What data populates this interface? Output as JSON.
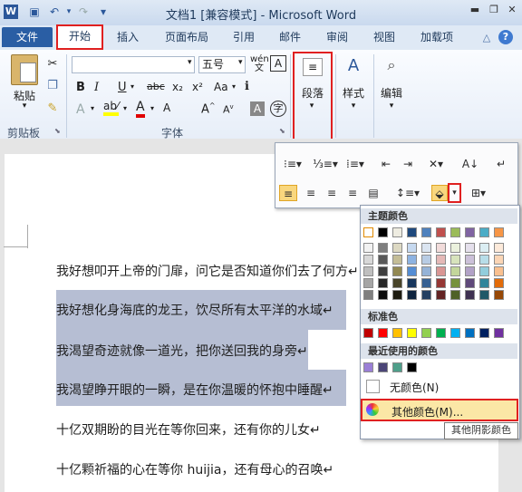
{
  "window": {
    "title": "文档1 [兼容模式] - Microsoft Word"
  },
  "tabs": [
    "文件",
    "开始",
    "插入",
    "页面布局",
    "引用",
    "邮件",
    "审阅",
    "视图",
    "加载项"
  ],
  "ribbon": {
    "paste_label": "粘贴",
    "clipboard_label": "剪贴板",
    "font_label": "字体",
    "font_size": "五号",
    "paragraph_label": "段落",
    "styles_label": "样式",
    "editing_label": "编辑"
  },
  "document": {
    "lines": [
      "我好想叩开上帝的门扉，问它是否知道你们去了何方↵",
      "我好想化身海底的龙王，饮尽所有太平洋的水域↵",
      "我渴望奇迹就像一道光，把你送回我的身旁↵",
      "我渴望睁开眼的一瞬，是在你温暖的怀抱中睡醒↵",
      "十亿双期盼的目光在等你回来，还有你的儿女↵",
      "十亿颗祈福的心在等你 huijia，还有母心的召唤↵"
    ]
  },
  "shading_menu": {
    "theme_colors_label": "主题颜色",
    "standard_colors_label": "标准色",
    "recent_colors_label": "最近使用的颜色",
    "no_color_label": "无颜色(N)",
    "more_colors_label": "其他颜色(M)...",
    "tooltip": "其他阴影颜色",
    "theme_top": [
      "#ffffff",
      "#000000",
      "#eeece1",
      "#1f497d",
      "#4f81bd",
      "#c0504d",
      "#9bbb59",
      "#8064a2",
      "#4bacc6",
      "#f79646"
    ],
    "theme_tints": [
      [
        "#f2f2f2",
        "#7f7f7f",
        "#ddd9c3",
        "#c6d9f0",
        "#dbe5f1",
        "#f2dcdb",
        "#ebf1dd",
        "#e5e0ec",
        "#dbeef3",
        "#fdeada"
      ],
      [
        "#d8d8d8",
        "#595959",
        "#c4bd97",
        "#8db3e2",
        "#b8cce4",
        "#e5b9b7",
        "#d7e3bc",
        "#ccc1d9",
        "#b7dde8",
        "#fbd5b5"
      ],
      [
        "#bfbfbf",
        "#3f3f3f",
        "#938953",
        "#548dd4",
        "#95b3d7",
        "#d99694",
        "#c3d69b",
        "#b2a2c7",
        "#92cddc",
        "#fac08f"
      ],
      [
        "#a5a5a5",
        "#262626",
        "#494429",
        "#17365d",
        "#366092",
        "#953734",
        "#76923c",
        "#5f497a",
        "#31859b",
        "#e36c09"
      ],
      [
        "#7f7f7f",
        "#0c0c0c",
        "#1d1b10",
        "#0f243e",
        "#244061",
        "#632423",
        "#4f6128",
        "#3f3151",
        "#205867",
        "#974806"
      ]
    ],
    "standard": [
      "#c00000",
      "#ff0000",
      "#ffc000",
      "#ffff00",
      "#92d050",
      "#00b050",
      "#00b0f0",
      "#0070c0",
      "#002060",
      "#7030a0"
    ],
    "recent": [
      "#9a7fd6",
      "#4b4577",
      "#4f9f8a",
      "#000000"
    ]
  }
}
